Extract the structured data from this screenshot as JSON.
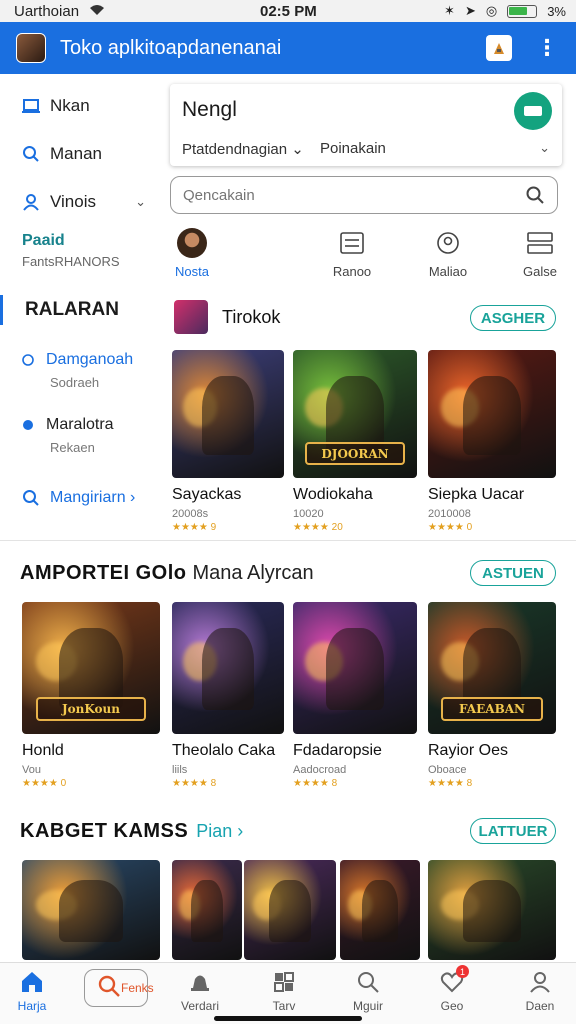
{
  "status": {
    "carrier": "Uarthoian",
    "time": "02:5 PM",
    "battery": "3%"
  },
  "appbar": {
    "title": "Toko aplkitoapdanenanai"
  },
  "sidebar": {
    "items": [
      {
        "label": "Nkan",
        "icon": "laptop-icon"
      },
      {
        "label": "Manan",
        "icon": "search-icon"
      },
      {
        "label": "Vinois",
        "icon": "user-icon"
      }
    ],
    "promo_title": "Paaid",
    "promo_sub": "FantsRHANORS",
    "section_title": "RALARAN",
    "sub1_title": "Damganoah",
    "sub1_desc": "Sodraeh",
    "sub2_title": "Maralotra",
    "sub2_desc": "Rekaen",
    "link": "Mangiriarn ›"
  },
  "card": {
    "title": "Nengl",
    "dd1": "Ptatdendnagian",
    "dd2": "Poinakain"
  },
  "search": {
    "placeholder": "Qencakain"
  },
  "categories": [
    {
      "label": "Nosta"
    },
    {
      "label": "Ranoo"
    },
    {
      "label": "Maliao"
    },
    {
      "label": "Galse"
    }
  ],
  "section1": {
    "title": "Tirokok",
    "action": "ASGHER",
    "tiles": [
      {
        "name": "Sayackas",
        "sub": "20008s",
        "stars": "★★★★ 9",
        "logo": "",
        "colors": [
          "#3d3f7a",
          "#e08a3a"
        ]
      },
      {
        "name": "Wodiokaha",
        "sub": "10020",
        "stars": "★★★★ 20",
        "logo": "DJOORAN",
        "colors": [
          "#2d5a2a",
          "#7ac43d"
        ]
      },
      {
        "name": "Siepka Uacar",
        "sub": "2010008",
        "stars": "★★★★ 0",
        "logo": "",
        "colors": [
          "#5a1a14",
          "#f0662a"
        ]
      }
    ]
  },
  "section2": {
    "title": "AMPORTEI GOlo",
    "title_light": "Mana Alyrcan",
    "action": "ASTUEN",
    "tiles": [
      {
        "name": "Honld",
        "sub": "Vou",
        "stars": "★★★★ 0",
        "logo": "JonKoun",
        "colors": [
          "#7a3a1a",
          "#f2b04a"
        ]
      },
      {
        "name": "Theolalo Caka",
        "sub": "liils",
        "stars": "★★★★ 8",
        "logo": "",
        "colors": [
          "#2a2a5a",
          "#b57ad6"
        ]
      },
      {
        "name": "Fdadaropsie",
        "sub": "Aadocroad",
        "stars": "★★★★ 8",
        "logo": "",
        "colors": [
          "#3a2a6a",
          "#e04ab0"
        ]
      },
      {
        "name": "Rayior Oes",
        "sub": "Oboace",
        "stars": "★★★★ 8",
        "logo": "FAEABAN",
        "colors": [
          "#1a3a2a",
          "#c85a2a"
        ]
      }
    ]
  },
  "section3": {
    "title": "KABGET KAMSS",
    "link": "Pian ›",
    "action": "LATTUER",
    "tiles": [
      {
        "colors": [
          "#2a4a6a",
          "#f0a03a"
        ]
      },
      {
        "colors": [
          "#3a2a4a",
          "#e86a3a"
        ]
      },
      {
        "colors": [
          "#4a2a5a",
          "#f2c04a"
        ]
      },
      {
        "colors": [
          "#3a1a2a",
          "#d8762a"
        ]
      },
      {
        "colors": [
          "#2a4a2a",
          "#e0a040"
        ]
      }
    ]
  },
  "nav": [
    {
      "label": "Harja"
    },
    {
      "label": "Fenks"
    },
    {
      "label": "Verdari"
    },
    {
      "label": "Tarv"
    },
    {
      "label": "Mguir"
    },
    {
      "label": "Geo",
      "badge": "1"
    },
    {
      "label": "Daen"
    }
  ]
}
